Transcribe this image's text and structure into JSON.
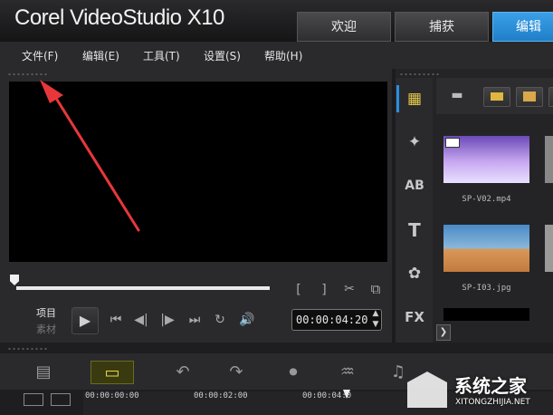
{
  "app": {
    "title": "Corel VideoStudio X10"
  },
  "top_tabs": [
    {
      "label": "欢迎"
    },
    {
      "label": "捕获"
    },
    {
      "label": "编辑"
    }
  ],
  "menu": [
    {
      "label": "文件(F)"
    },
    {
      "label": "编辑(E)"
    },
    {
      "label": "工具(T)"
    },
    {
      "label": "设置(S)"
    },
    {
      "label": "帮助(H)"
    }
  ],
  "player": {
    "mode_project": "项目",
    "mode_clip": "素材",
    "timecode": "00:00:04:20"
  },
  "library": {
    "items": [
      {
        "name": "SP-V02.mp4"
      },
      {
        "name": "SP-I03.jpg"
      }
    ]
  },
  "timeline": {
    "ticks": [
      "00:00:00:00",
      "00:00:02:00",
      "00:00:04:0"
    ]
  },
  "watermark": {
    "text": "系统之家",
    "url": "XITONGZHIJIA.NET"
  },
  "colors": {
    "accent": "#2a8fe0",
    "annotation": "#e8373a"
  }
}
